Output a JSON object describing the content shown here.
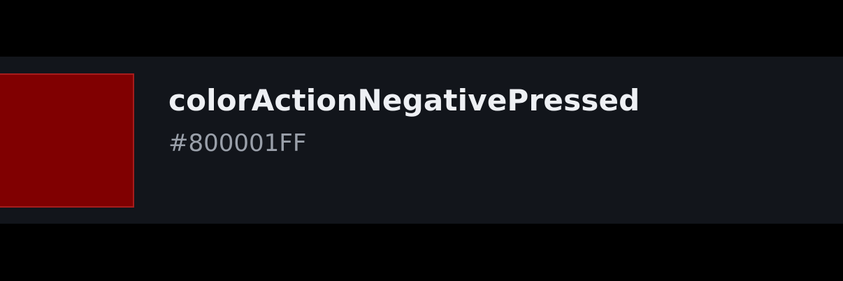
{
  "token": {
    "name": "colorActionNegativePressed",
    "value": "#800001FF",
    "swatch_color": "#800001",
    "swatch_border_color": "#a61c1c"
  },
  "colors": {
    "page_background": "#000000",
    "card_background": "#12151b",
    "name_text": "#eef0f4",
    "value_text": "#9aa0aa"
  }
}
